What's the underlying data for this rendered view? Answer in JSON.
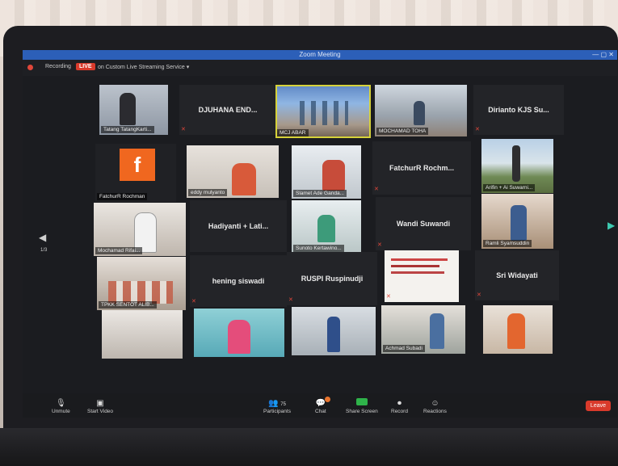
{
  "window": {
    "title": "Zoom Meeting"
  },
  "recording": {
    "label": "Recording",
    "live": "LIVE",
    "stream": "on Custom Live Streaming Service",
    "caret": "▾"
  },
  "pager": {
    "page": "1/3",
    "prev": "◀",
    "next": "▶"
  },
  "tiles": [
    {
      "name": "Tatang TatangKarti...",
      "type": "video"
    },
    {
      "name": "DJUHANA END...",
      "type": "name"
    },
    {
      "name": "MOCHAMAD TOHA",
      "type": "video"
    },
    {
      "name": "Dirianto KJS Su...",
      "type": "name"
    },
    {
      "name": "FatchurR Rochman",
      "type": "avatar",
      "avatar": "f"
    },
    {
      "name": "eddy mulyanto",
      "type": "video"
    },
    {
      "name": "Slamet Ade Ganda...",
      "type": "video"
    },
    {
      "name": "FatchurR Rochm...",
      "type": "name"
    },
    {
      "name": "Arifin + Ai Suwarni...",
      "type": "video"
    },
    {
      "name": "Mochamad Rifai...",
      "type": "video"
    },
    {
      "name": "Hadiyanti + Lati...",
      "type": "name"
    },
    {
      "name": "Sunoto Kertawino...",
      "type": "video"
    },
    {
      "name": "Wandi Suwandi",
      "type": "name"
    },
    {
      "name": "Ramli Syamsuddin",
      "type": "video"
    },
    {
      "name": "TPKK SENTOT ALIB...",
      "type": "video"
    },
    {
      "name": "hening siswadi",
      "type": "name"
    },
    {
      "name": "RUSPI Ruspinudji",
      "type": "name"
    },
    {
      "name": "Sri Widayati",
      "type": "name"
    },
    {
      "name": "Achmad Subadi",
      "type": "video"
    }
  ],
  "toolbar": {
    "unmute": "Unmute",
    "start_video": "Start Video",
    "participants": "Participants",
    "participants_count": "75",
    "chat": "Chat",
    "share_screen": "Share Screen",
    "record": "Record",
    "reactions": "Reactions",
    "leave": "Leave"
  },
  "colors": {
    "accent": "#2c5fb8",
    "live": "#d93a2b",
    "active_speaker": "#d6d23a",
    "avatar": "#f0671f"
  }
}
